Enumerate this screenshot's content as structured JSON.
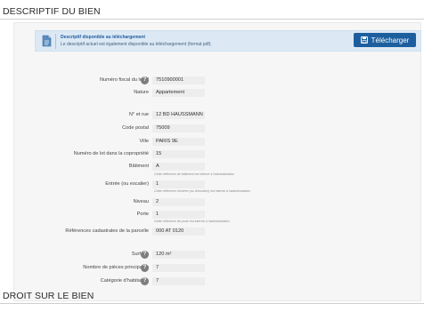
{
  "sections": {
    "descriptif_title": "DESCRIPTIF DU BIEN",
    "droit_title": "DROIT SUR LE BIEN"
  },
  "banner": {
    "title": "Descriptif disponible au téléchargement",
    "text": "Le descriptif actuel est également disponible au téléchargement (format pdf).",
    "button_label": "Télécharger",
    "icon": "document-icon",
    "button_icon": "save-icon"
  },
  "fields": {
    "numero_fiscal": {
      "label": "Numéro fiscal du local",
      "value": "7510900001",
      "has_help": true
    },
    "nature": {
      "label": "Nature",
      "value": "Appartement"
    },
    "rue": {
      "label": "N° et rue",
      "value": "12 BD HAUSSMANN"
    },
    "code_postal": {
      "label": "Code postal",
      "value": "75009"
    },
    "ville": {
      "label": "Ville",
      "value": "PARIS 9E"
    },
    "lot": {
      "label": "Numéro de lot dans la copropriété",
      "value": "15"
    },
    "batiment": {
      "label": "Bâtiment",
      "value": "A",
      "hint": "Cette référence de bâtiment est interne à l'administration"
    },
    "entree": {
      "label": "Entrée (ou escalier)",
      "value": "1",
      "hint": "Cette référence d'entrée (ou d'escalier) est interne à l'administration"
    },
    "niveau": {
      "label": "Niveau",
      "value": "2"
    },
    "porte": {
      "label": "Porte",
      "value": "1",
      "hint": "Cette référence de porte est interne à l'administration"
    },
    "cadastre": {
      "label": "Références cadastrales de la parcelle",
      "value": "000 AT 0120"
    },
    "surface": {
      "label": "Surface",
      "value": "120 m²",
      "has_help": true
    },
    "pieces": {
      "label": "Nombre de pièces principales",
      "value": "7",
      "has_help": true
    },
    "categorie": {
      "label": "Catégorie d'habitation",
      "value": "7",
      "has_help": true
    }
  },
  "colors": {
    "banner_bg": "#dce9f5",
    "button_bg": "#1d5f9e",
    "card_bg": "#f6f6f6",
    "value_bg": "#ededed"
  }
}
